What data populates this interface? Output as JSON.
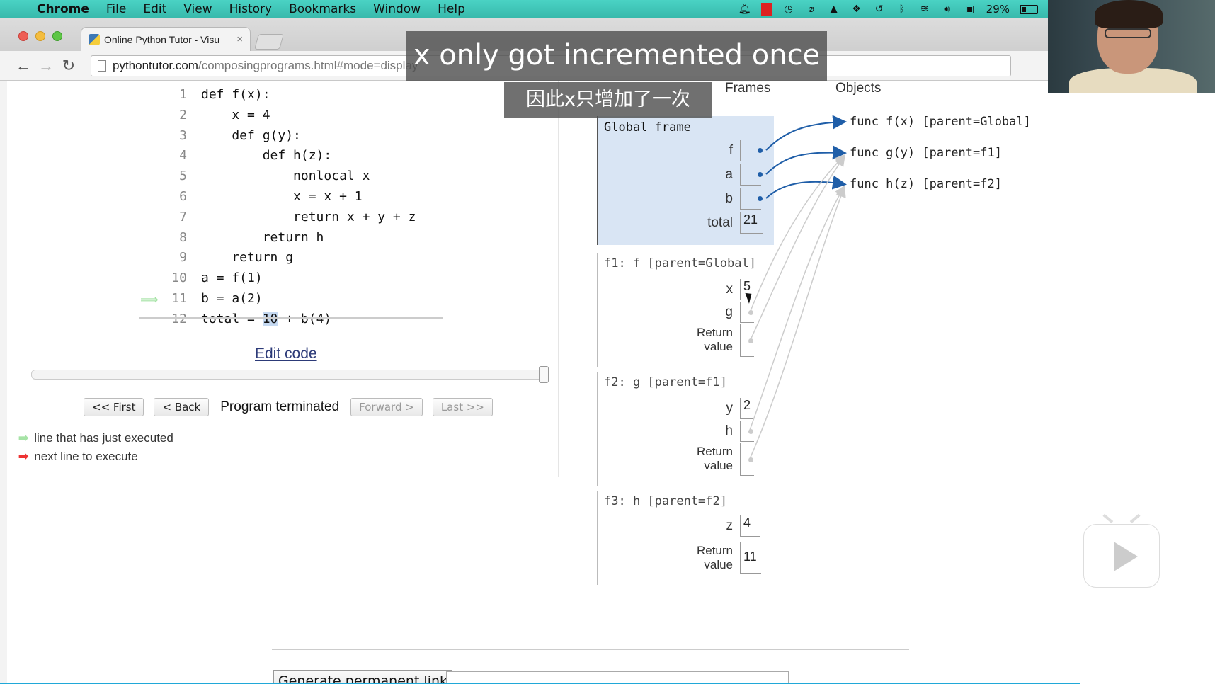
{
  "menubar": {
    "items": [
      "Chrome",
      "File",
      "Edit",
      "View",
      "History",
      "Bookmarks",
      "Window",
      "Help"
    ],
    "battery": "29%"
  },
  "browser": {
    "tab_title": "Online Python Tutor - Visu",
    "tab_close": "×",
    "url_host": "pythontutor.com",
    "url_path": "/composingprograms.html#mode=display"
  },
  "code": {
    "lines": [
      {
        "n": "1",
        "text": "def f(x):"
      },
      {
        "n": "2",
        "text": "    x = 4"
      },
      {
        "n": "3",
        "text": "    def g(y):"
      },
      {
        "n": "4",
        "text": "        def h(z):"
      },
      {
        "n": "5",
        "text": "            nonlocal x"
      },
      {
        "n": "6",
        "text": "            x = x + 1"
      },
      {
        "n": "7",
        "text": "            return x + y + z"
      },
      {
        "n": "8",
        "text": "        return h"
      },
      {
        "n": "9",
        "text": "    return g"
      },
      {
        "n": "10",
        "text": "a = f(1)"
      },
      {
        "n": "11",
        "text": "b = a(2)"
      }
    ],
    "last_line_num": "12",
    "last_line_pre": "total = ",
    "last_line_hl": "10",
    "last_line_post": " + b(4)"
  },
  "edit_code_label": "Edit code",
  "controls": {
    "first": "<< First",
    "back": "< Back",
    "status": "Program terminated",
    "forward": "Forward >",
    "last": "Last >>"
  },
  "legend": {
    "executed": "line that has just executed",
    "next": "next line to execute"
  },
  "viz": {
    "frames_header": "Frames",
    "objects_header": "Objects",
    "global": {
      "title": "Global frame",
      "vars": [
        "f",
        "a",
        "b",
        "total"
      ],
      "total_value": "21"
    },
    "f1": {
      "title": "f1: f [parent=Global]",
      "x_name": "x",
      "x_value": "5",
      "g_name": "g",
      "ret_label_1": "Return",
      "ret_label_2": "value"
    },
    "f2": {
      "title": "f2: g [parent=f1]",
      "y_name": "y",
      "y_value": "2",
      "h_name": "h",
      "ret_label_1": "Return",
      "ret_label_2": "value"
    },
    "f3": {
      "title": "f3: h [parent=f2]",
      "z_name": "z",
      "z_value": "4",
      "ret_label_1": "Return",
      "ret_label_2": "value",
      "ret_value": "11"
    },
    "objects": [
      "func f(x) [parent=Global]",
      "func g(y) [parent=f1]",
      "func h(z) [parent=f2]"
    ]
  },
  "perm_button": "Generate permanent link",
  "subtitles": {
    "en": "x only got incremented once",
    "zh": "因此x只增加了一次"
  }
}
